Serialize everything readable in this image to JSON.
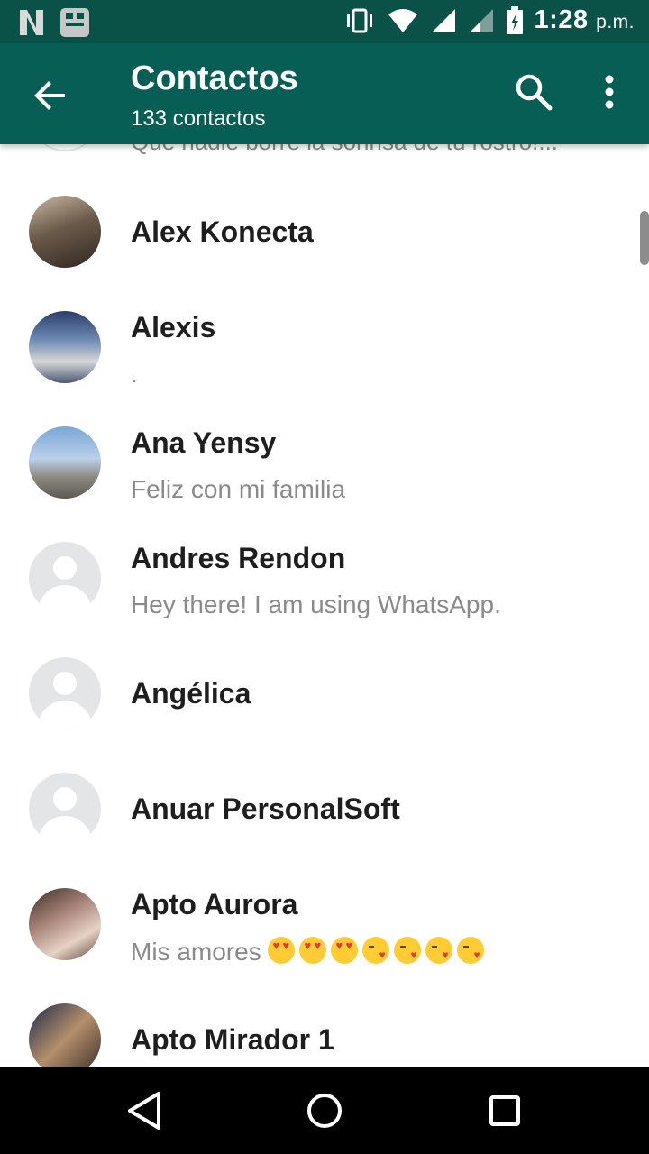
{
  "status_bar": {
    "time": "1:28",
    "ampm": "p.m.",
    "icons": [
      "netflix-notification-icon",
      "app-notification-icon",
      "vibrate-icon",
      "wifi-icon",
      "signal-icon",
      "signal-weak-icon",
      "battery-charging-icon"
    ]
  },
  "app_bar": {
    "title": "Contactos",
    "subtitle": "133 contactos",
    "back_icon": "arrow-left-icon",
    "search_icon": "search-icon",
    "more_icon": "more-vert-icon",
    "color": "#075e54"
  },
  "partial_row": {
    "status": "Que nadie borre la sonrisa de tu rostro!..."
  },
  "contacts": [
    {
      "name": "Alex Konecta",
      "status": "",
      "avatar": "photo"
    },
    {
      "name": "Alexis",
      "status": ".",
      "avatar": "photo"
    },
    {
      "name": "Ana Yensy",
      "status": "Feliz con mi familia",
      "avatar": "photo"
    },
    {
      "name": "Andres Rendon",
      "status": "Hey there! I am using WhatsApp.",
      "avatar": "placeholder"
    },
    {
      "name": "Angélica",
      "status": "",
      "avatar": "placeholder"
    },
    {
      "name": "Anuar PersonalSoft",
      "status": "",
      "avatar": "placeholder"
    },
    {
      "name": "Apto Aurora",
      "status": "Mis amores",
      "status_emoji": [
        "heart-eyes",
        "heart-eyes",
        "heart-eyes",
        "kiss",
        "kiss",
        "kiss",
        "kiss"
      ],
      "avatar": "photo"
    },
    {
      "name": "Apto Mirador 1",
      "status": "",
      "avatar": "photo"
    }
  ],
  "nav_bar": {
    "back_icon": "triangle-back-icon",
    "home_icon": "circle-home-icon",
    "recents_icon": "square-recents-icon"
  }
}
